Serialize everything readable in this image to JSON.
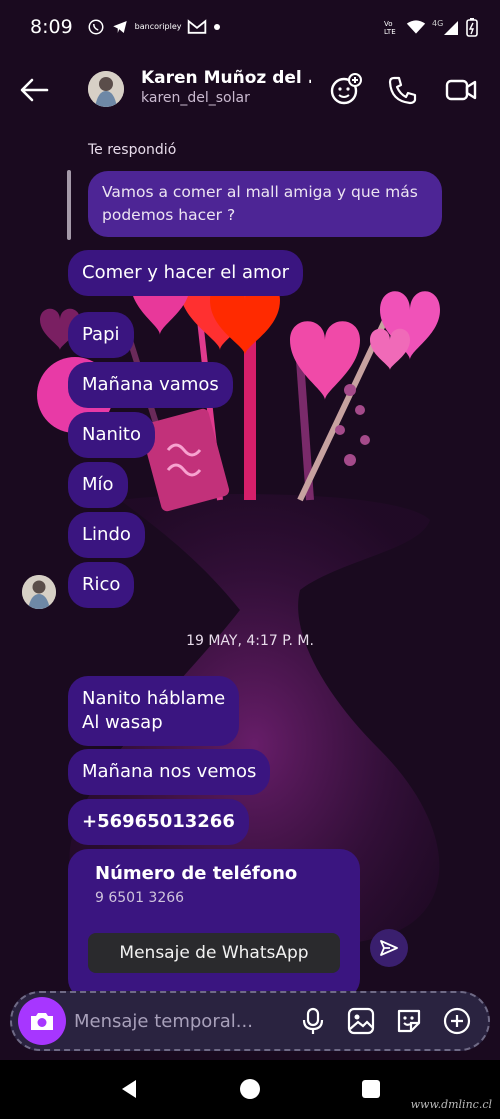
{
  "status_bar": {
    "time": "8:09",
    "bank_label_1": "banco",
    "bank_label_2": "ripley",
    "network": "4G"
  },
  "header": {
    "name": "Karen Muñoz del ...",
    "username": "karen_del_solar"
  },
  "reply": {
    "label": "Te respondió",
    "quoted": [
      "Vamos a comer al mall amiga y que más",
      "podemos hacer ?"
    ]
  },
  "messages_1": [
    "Comer y hacer el amor",
    "Papi",
    "Mañana vamos",
    "Nanito",
    "Mío",
    "Lindo",
    "Rico"
  ],
  "date_separator": "19 MAY, 4:17 P. M.",
  "messages_2": [
    [
      "Nanito háblame",
      "Al wasap"
    ],
    "Mañana nos vemos",
    "+56965013266"
  ],
  "phone_card": {
    "title": "Número de teléfono",
    "number": "9 6501 3266",
    "whatsapp_button": "Mensaje de WhatsApp"
  },
  "composer": {
    "placeholder": "Mensaje temporal..."
  },
  "watermark": "www.dmlinc.cl",
  "colors": {
    "bubble": "#3a1580",
    "camera_button": "#a736ff",
    "background": "#1a0a1f"
  }
}
